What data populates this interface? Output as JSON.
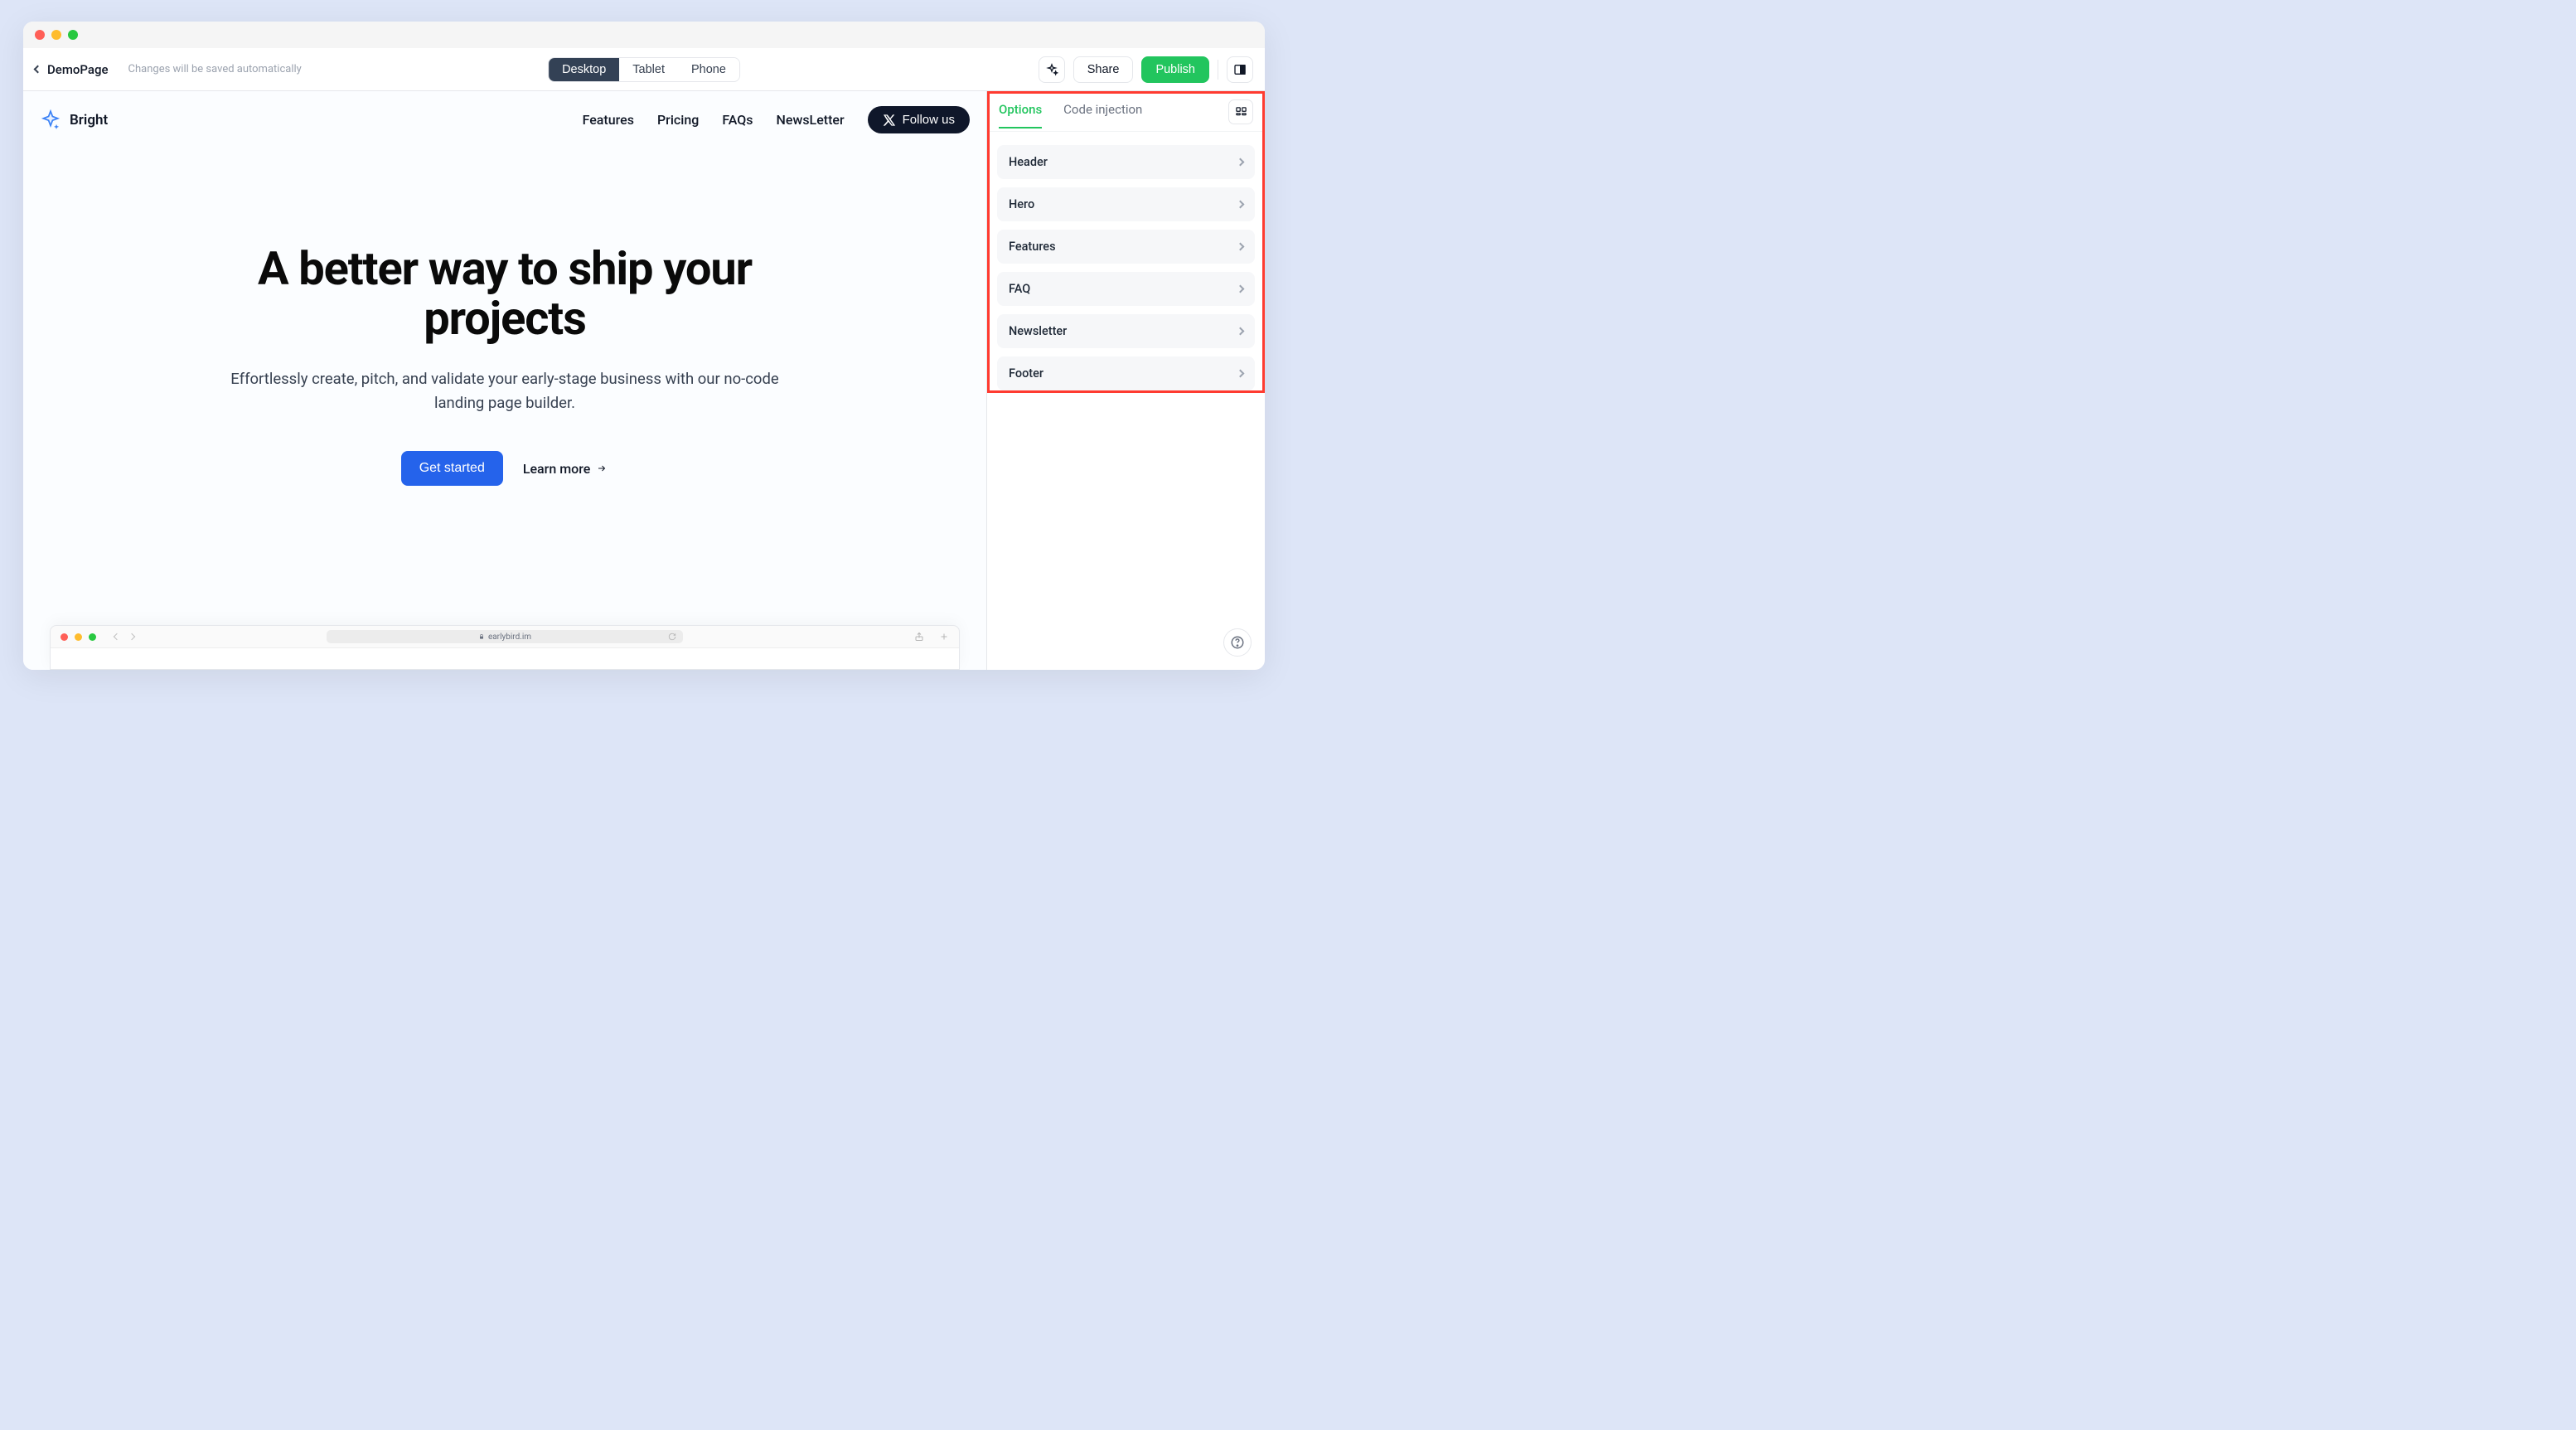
{
  "toolbar": {
    "page_name": "DemoPage",
    "autosave": "Changes will be saved automatically",
    "viewports": {
      "desktop": "Desktop",
      "tablet": "Tablet",
      "phone": "Phone"
    },
    "share": "Share",
    "publish": "Publish"
  },
  "site_header": {
    "brand": "Bright",
    "nav": {
      "features": "Features",
      "pricing": "Pricing",
      "faqs": "FAQs",
      "newsletter": "NewsLetter"
    },
    "follow_label": "Follow us"
  },
  "hero": {
    "title": "A better way to ship your projects",
    "subtitle": "Effortlessly create, pitch, and validate your early-stage business with our no-code landing page builder.",
    "cta_primary": "Get started",
    "cta_secondary": "Learn more"
  },
  "safari": {
    "url": "earlybird.im"
  },
  "sidepanel": {
    "tabs": {
      "options": "Options",
      "code": "Code injection"
    },
    "sections": {
      "header": "Header",
      "hero": "Hero",
      "features": "Features",
      "faq": "FAQ",
      "newsletter": "Newsletter",
      "footer": "Footer"
    }
  }
}
